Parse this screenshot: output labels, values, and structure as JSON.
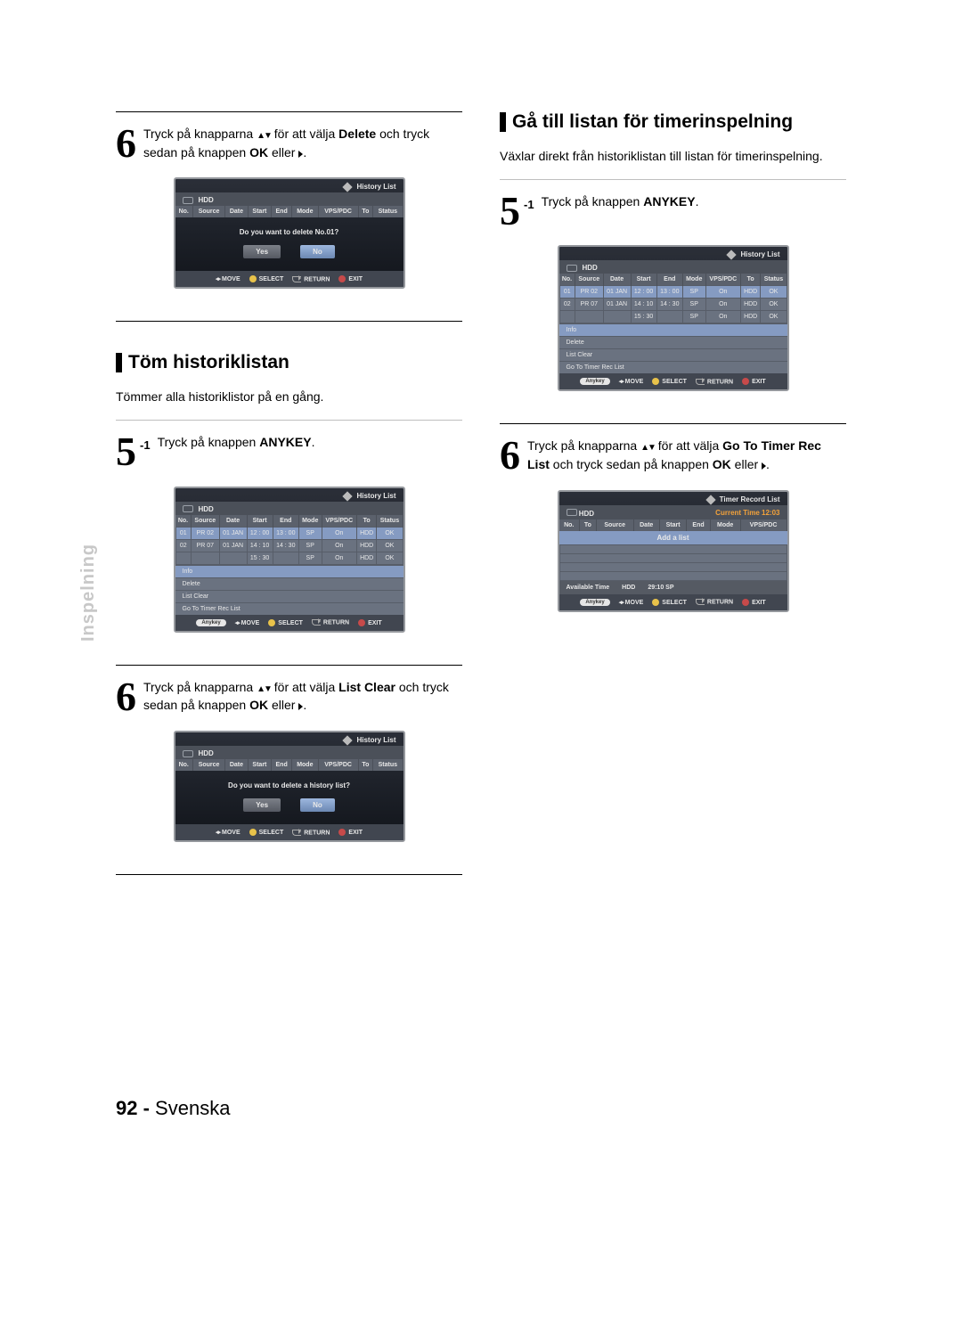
{
  "sideTab": "Inspelning",
  "pageNumber": {
    "num": "92 -",
    "lang": "Svenska"
  },
  "left": {
    "step6a": {
      "textBefore": "Tryck på knapparna ",
      "bold": "Delete",
      "textMid": " för att välja ",
      "textAfter": " och tryck sedan på knappen ",
      "bold2": "OK",
      "textTail": " eller"
    },
    "sectionTitle1": "Töm historiklistan",
    "subtitle1": "Tömmer alla historiklistor på en gång.",
    "step5_1": {
      "sup": "-1",
      "text": "Tryck på knappen ",
      "bold": "ANYKEY",
      "tail": "."
    },
    "step6b": {
      "textBefore": "Tryck på knapparna ",
      "textMid": " för att välja ",
      "bold": "List Clear",
      "textAfter": " och tryck sedan på knappen ",
      "bold2": "OK",
      "textTail": " eller"
    },
    "fig1": {
      "title": "History List",
      "sub": "HDD",
      "headers": [
        "No.",
        "Source",
        "Date",
        "Start",
        "End",
        "Mode",
        "VPS/PDC",
        "To",
        "Status"
      ],
      "prompt": "Do you want to delete No.01?",
      "yes": "Yes",
      "no": "No",
      "foot": {
        "move": "MOVE",
        "select": "SELECT",
        "return": "RETURN",
        "exit": "EXIT"
      }
    },
    "fig2": {
      "title": "History List",
      "sub": "HDD",
      "headers": [
        "No.",
        "Source",
        "Date",
        "Start",
        "End",
        "Mode",
        "VPS/PDC",
        "To",
        "Status"
      ],
      "rows": [
        [
          "01",
          "PR 02",
          "01 JAN",
          "12 : 00",
          "13 : 00",
          "SP",
          "On",
          "HDD",
          "OK"
        ],
        [
          "02",
          "PR 07",
          "01 JAN",
          "14 : 10",
          "14 : 30",
          "SP",
          "On",
          "HDD",
          "OK"
        ],
        [
          "",
          "",
          "",
          "15 : 30",
          "",
          "SP",
          "On",
          "HDD",
          "OK"
        ]
      ],
      "menu": [
        "Info",
        "Delete",
        "List Clear",
        "Go To Timer Rec List"
      ],
      "anykey": "Anykey",
      "foot": {
        "move": "MOVE",
        "select": "SELECT",
        "return": "RETURN",
        "exit": "EXIT"
      }
    },
    "fig3": {
      "title": "History List",
      "sub": "HDD",
      "headers": [
        "No.",
        "Source",
        "Date",
        "Start",
        "End",
        "Mode",
        "VPS/PDC",
        "To",
        "Status"
      ],
      "prompt": "Do you want to delete a history list?",
      "yes": "Yes",
      "no": "No",
      "foot": {
        "move": "MOVE",
        "select": "SELECT",
        "return": "RETURN",
        "exit": "EXIT"
      }
    }
  },
  "right": {
    "sectionTitle": "Gå till listan för timerinspelning",
    "subtitle": "Växlar direkt från historiklistan till listan för timerinspelning.",
    "step5_1": {
      "sup": "-1",
      "text": "Tryck på knappen ",
      "bold": "ANYKEY",
      "tail": "."
    },
    "step6": {
      "textBefore": "Tryck på knapparna ",
      "textMid": " för att välja ",
      "bold": "Go To Timer Rec List",
      "textAfter": " och tryck sedan på knappen ",
      "bold2": "OK",
      "textTail": " eller"
    },
    "fig1": {
      "title": "History List",
      "sub": "HDD",
      "headers": [
        "No.",
        "Source",
        "Date",
        "Start",
        "End",
        "Mode",
        "VPS/PDC",
        "To",
        "Status"
      ],
      "rows": [
        [
          "01",
          "PR 02",
          "01 JAN",
          "12 : 00",
          "13 : 00",
          "SP",
          "On",
          "HDD",
          "OK"
        ],
        [
          "02",
          "PR 07",
          "01 JAN",
          "14 : 10",
          "14 : 30",
          "SP",
          "On",
          "HDD",
          "OK"
        ],
        [
          "",
          "",
          "",
          "15 : 30",
          "",
          "SP",
          "On",
          "HDD",
          "OK"
        ]
      ],
      "menu": [
        "Info",
        "Delete",
        "List Clear",
        "Go To Timer Rec List"
      ],
      "anykey": "Anykey",
      "foot": {
        "move": "MOVE",
        "select": "SELECT",
        "return": "RETURN",
        "exit": "EXIT"
      }
    },
    "fig2": {
      "title": "Timer Record List",
      "sub": "HDD",
      "time": "Current Time 12:03",
      "headers": [
        "No.",
        "To",
        "Source",
        "Date",
        "Start",
        "End",
        "Mode",
        "VPS/PDC"
      ],
      "addList": "Add a list",
      "avail": {
        "label": "Available Time",
        "hdd": "HDD",
        "time": "29:10 SP"
      },
      "anykey": "Anykey",
      "foot": {
        "move": "MOVE",
        "select": "SELECT",
        "return": "RETURN",
        "exit": "EXIT"
      }
    }
  }
}
